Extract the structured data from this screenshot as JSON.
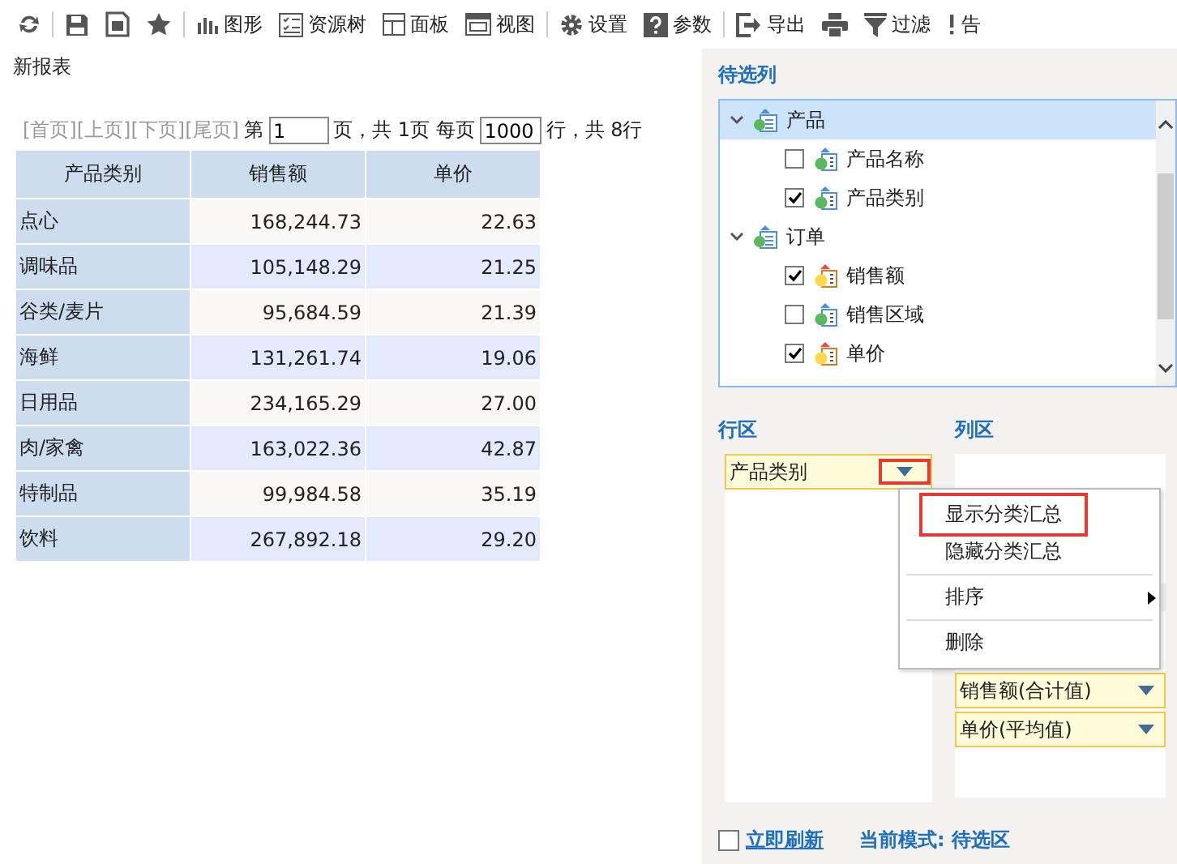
{
  "toolbar": [
    {
      "kind": "button"
    },
    {
      "kind": "separator"
    },
    {
      "kind": "button"
    },
    {
      "kind": "button"
    },
    {
      "kind": "button"
    },
    {
      "kind": "separator"
    },
    {
      "kind": "button",
      "label": "图形"
    },
    {
      "kind": "button",
      "label": "资源树"
    },
    {
      "kind": "button",
      "label": "面板"
    },
    {
      "kind": "button",
      "label": "视图"
    },
    {
      "kind": "separator"
    },
    {
      "kind": "button",
      "label": "设置"
    },
    {
      "kind": "button",
      "label": "参数"
    },
    {
      "kind": "separator"
    },
    {
      "kind": "button",
      "label": "导出"
    },
    {
      "kind": "button"
    },
    {
      "kind": "button",
      "label": "过滤"
    },
    {
      "kind": "button",
      "label": "告"
    }
  ],
  "report": {
    "title": "新报表",
    "pager": {
      "links": [
        "[首页]",
        "[上页]",
        "[下页]",
        "[尾页]"
      ],
      "page_prefix": "第",
      "page_value": "1",
      "page_suffix": "页，共 1页 每页",
      "rows_value": "1000",
      "rows_suffix": "行，共 8行"
    },
    "table": {
      "columns": [
        "产品类别",
        "销售额",
        "单价"
      ],
      "rows": [
        [
          "点心",
          "168,244.73",
          "22.63"
        ],
        [
          "调味品",
          "105,148.29",
          "21.25"
        ],
        [
          "谷类/麦片",
          "95,684.59",
          "21.39"
        ],
        [
          "海鲜",
          "131,261.74",
          "19.06"
        ],
        [
          "日用品",
          "234,165.29",
          "27.00"
        ],
        [
          "肉/家禽",
          "163,022.36",
          "42.87"
        ],
        [
          "特制品",
          "99,984.58",
          "35.19"
        ],
        [
          "饮料",
          "267,892.18",
          "29.20"
        ]
      ]
    }
  },
  "panel": {
    "candidates_title": "待选列",
    "tree": [
      {
        "label": "产品",
        "expanded": true,
        "selected": true,
        "children": [
          {
            "label": "产品名称",
            "checked": false,
            "kind": "dimension"
          },
          {
            "label": "产品类别",
            "checked": true,
            "kind": "dimension"
          }
        ]
      },
      {
        "label": "订单",
        "expanded": true,
        "selected": false,
        "children": [
          {
            "label": "销售额",
            "checked": true,
            "kind": "measure"
          },
          {
            "label": "销售区域",
            "checked": false,
            "kind": "dimension"
          },
          {
            "label": "单价",
            "checked": true,
            "kind": "measure"
          }
        ]
      }
    ],
    "row_area": {
      "title": "行区",
      "items": [
        "产品类别"
      ]
    },
    "column_area": {
      "title": "列区"
    },
    "value_items": [
      "销售额(合计值)",
      "单价(平均值)"
    ],
    "menu": [
      {
        "label": "显示分类汇总",
        "highlighted": true,
        "submenu": false
      },
      {
        "label": "隐藏分类汇总",
        "highlighted": false,
        "submenu": false
      },
      {
        "label": "排序",
        "highlighted": false,
        "submenu": true
      },
      {
        "label": "删除",
        "highlighted": false,
        "submenu": false
      }
    ],
    "auto_refresh": {
      "label": "立即刷新",
      "checked": false
    },
    "mode": "当前模式: 待选区"
  }
}
